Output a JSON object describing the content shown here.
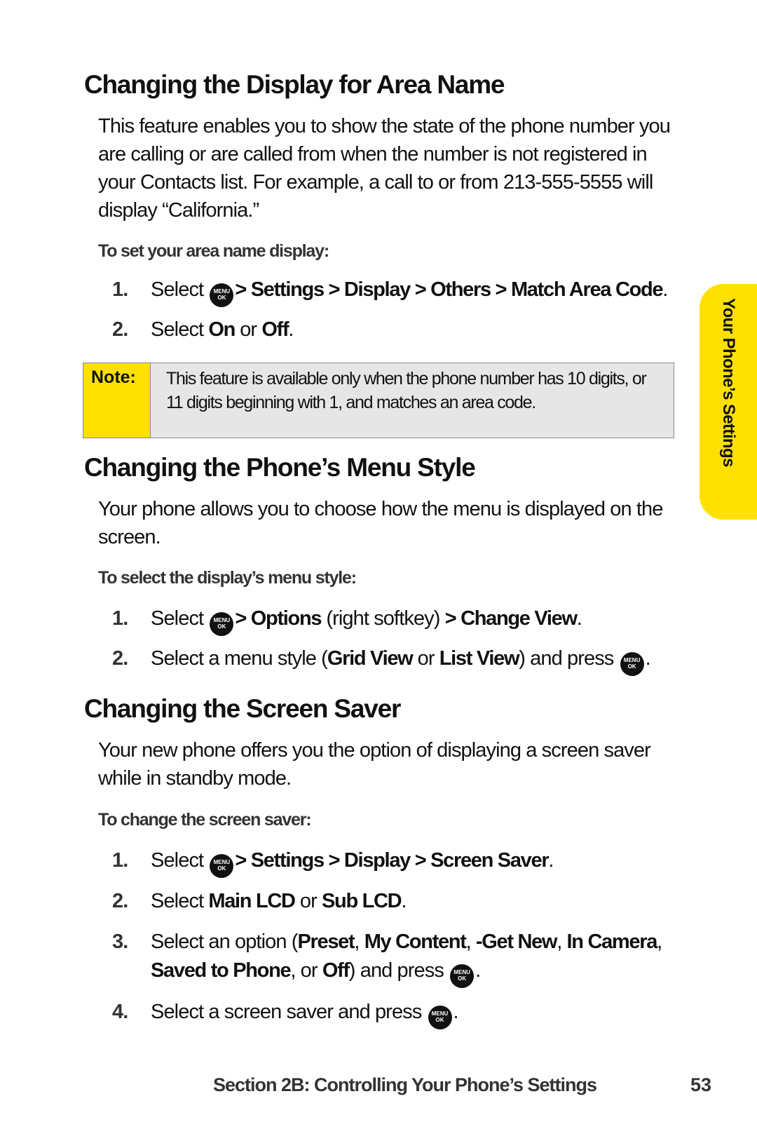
{
  "sections": [
    {
      "title": "Changing the Display for Area Name",
      "body": "This feature enables you to show the state of the phone number you are calling or are called from when the number is not registered in your Contacts list. For example, a call to or from 213-555-5555 will display “California.”",
      "procedure_title": "To set your area name display:",
      "steps": [
        {
          "num": "1.",
          "parts": [
            "Select",
            "MENU_KEY",
            "> Settings > Display > Others > Match Area Code",
            "."
          ]
        },
        {
          "num": "2.",
          "parts": [
            "Select ",
            "On",
            " or ",
            "Off",
            "."
          ]
        }
      ]
    },
    {
      "title": "Changing the Phone’s Menu Style",
      "body": "Your phone allows you to choose how the menu is displayed on the screen.",
      "procedure_title": "To select the display’s menu style:",
      "steps": [
        {
          "num": "1.",
          "parts": [
            "Select",
            "MENU_KEY",
            "> Options",
            " (right softkey) ",
            "> Change View",
            "."
          ]
        },
        {
          "num": "2.",
          "parts": [
            "Select a menu style (",
            "Grid View",
            " or ",
            "List View",
            ") and press",
            "MENU_KEY",
            "."
          ]
        }
      ]
    },
    {
      "title": "Changing the Screen Saver",
      "body": "Your new phone offers you the option of displaying a screen saver while in standby mode.",
      "procedure_title": "To change the screen saver:",
      "steps": [
        {
          "num": "1.",
          "parts": [
            "Select",
            "MENU_KEY",
            "> Settings > Display > Screen Saver",
            "."
          ]
        },
        {
          "num": "2.",
          "parts": [
            "Select ",
            "Main LCD",
            " or ",
            "Sub LCD",
            "."
          ]
        },
        {
          "num": "3.",
          "parts": [
            "Select an option (",
            "Preset",
            ", ",
            "My Content",
            ", ",
            "-Get New",
            ", ",
            "In Camera",
            ", ",
            "Saved to Phone",
            ", or ",
            "Off",
            ") and press",
            "MENU_KEY",
            "."
          ]
        },
        {
          "num": "4.",
          "parts": [
            "Select a screen saver and press",
            "MENU_KEY",
            "."
          ]
        }
      ]
    }
  ],
  "note": {
    "label": "Note:",
    "text": "This feature is available only when the phone number has 10 digits, or 11 digits beginning with 1, and matches an area code."
  },
  "menu_key": {
    "line1": "MENU",
    "line2": "OK",
    "icon": "menu-ok-key-icon"
  },
  "side_tab": {
    "label": "Your Phone’s Settings"
  },
  "footer": {
    "section": "Section 2B: Controlling Your Phone’s Settings",
    "page_number": "53"
  },
  "colors": {
    "accent_yellow": "#ffe000",
    "note_bg": "#e6e6e6",
    "text": "#111111"
  }
}
